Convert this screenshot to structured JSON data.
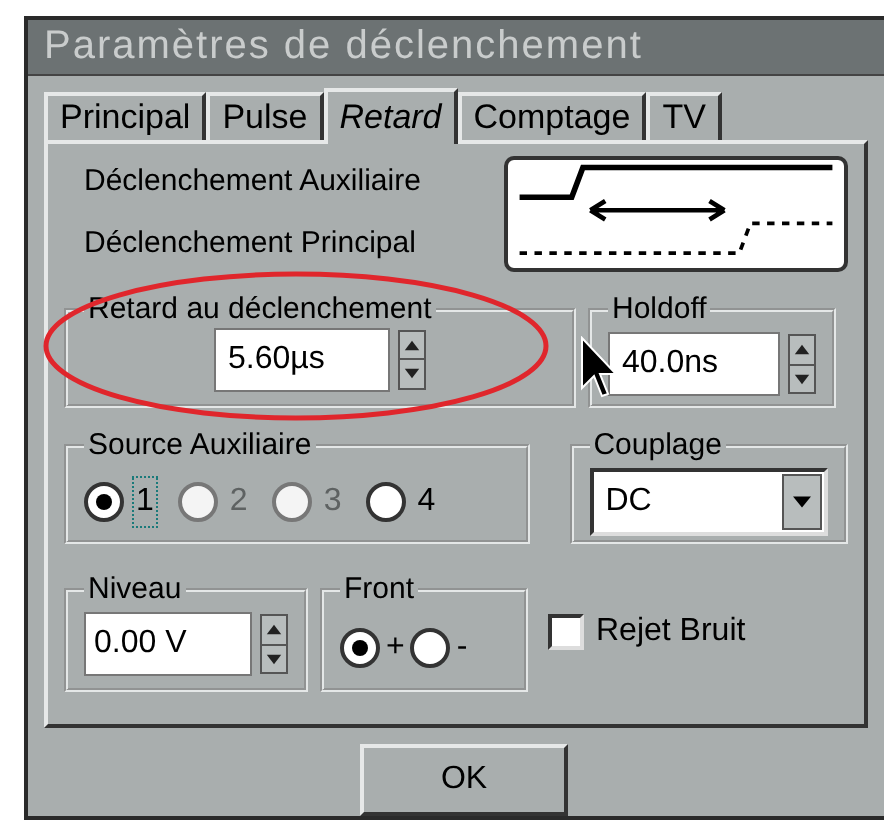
{
  "window": {
    "title": "Paramètres de déclenchement"
  },
  "tabs": [
    {
      "label": "Principal",
      "selected": false
    },
    {
      "label": "Pulse",
      "selected": false
    },
    {
      "label": "Retard",
      "selected": true
    },
    {
      "label": "Comptage",
      "selected": false
    },
    {
      "label": "TV",
      "selected": false
    }
  ],
  "trigger_labels": [
    "Déclenchement Auxiliaire",
    "Déclenchement Principal"
  ],
  "delay": {
    "label": "Retard au déclenchement",
    "value": "5.60µs"
  },
  "holdoff": {
    "label": "Holdoff",
    "value": "40.0ns"
  },
  "aux_source": {
    "label": "Source Auxiliaire",
    "options": [
      {
        "label": "1",
        "selected": true,
        "disabled": false,
        "focused": true
      },
      {
        "label": "2",
        "selected": false,
        "disabled": true,
        "focused": false
      },
      {
        "label": "3",
        "selected": false,
        "disabled": true,
        "focused": false
      },
      {
        "label": "4",
        "selected": false,
        "disabled": false,
        "focused": false
      }
    ]
  },
  "coupling": {
    "label": "Couplage",
    "value": "DC"
  },
  "trigger_level": {
    "label": "Niveau",
    "value": "0.00 V"
  },
  "edge": {
    "label": "Front",
    "options": [
      {
        "label": "+",
        "selected": true
      },
      {
        "label": "-",
        "selected": false
      }
    ]
  },
  "noise_reject": {
    "label": "Rejet Bruit",
    "checked": false
  },
  "buttons": [
    "OK"
  ]
}
